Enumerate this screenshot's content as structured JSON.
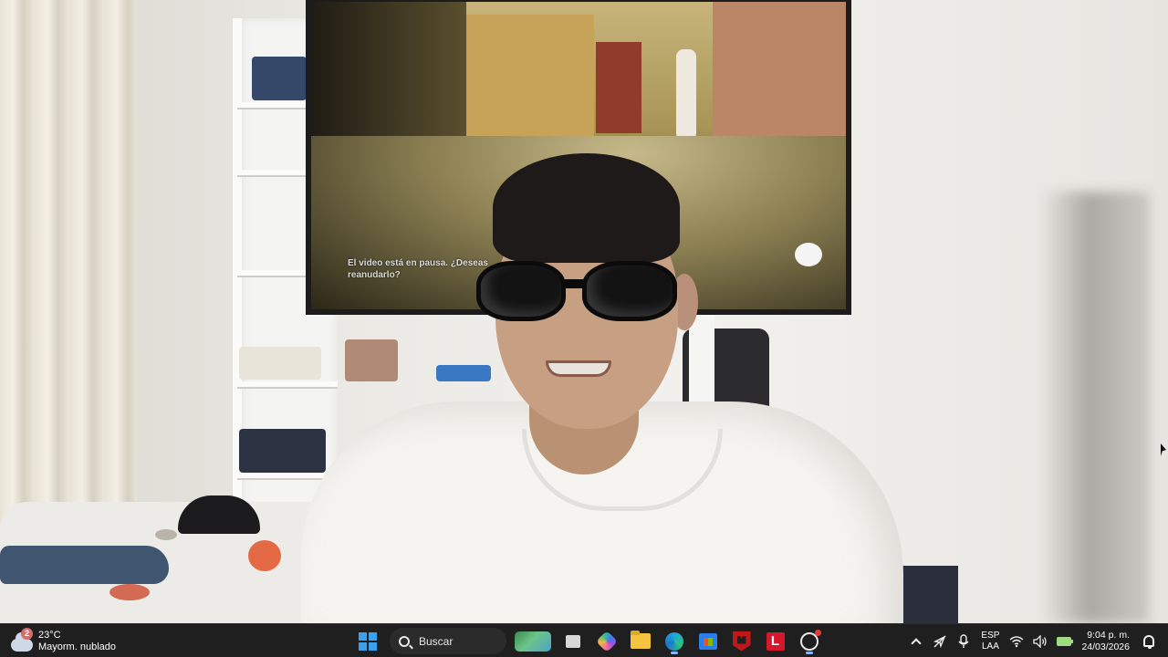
{
  "camera_feed": {
    "description": "",
    "tv_subtitle": "El video está en pausa. ¿Deseas reanudarlo?"
  },
  "taskbar": {
    "weather": {
      "temperature": "23°C",
      "condition": "Mayorm. nublado",
      "badge": "2"
    },
    "start_icon": "windows-logo",
    "search": {
      "label": "Buscar"
    },
    "pinned_apps": [
      {
        "name": "widgets",
        "icon": "widget-landscape"
      },
      {
        "name": "task-view",
        "icon": "taskview-icon"
      },
      {
        "name": "copilot",
        "icon": "copilot-icon"
      },
      {
        "name": "file-explorer",
        "icon": "folder-icon"
      },
      {
        "name": "edge",
        "icon": "edge-icon"
      },
      {
        "name": "microsoft-store",
        "icon": "store-icon"
      },
      {
        "name": "mcafee",
        "icon": "shield-icon"
      },
      {
        "name": "l-app",
        "icon": "l-icon",
        "label": "L"
      },
      {
        "name": "chatgpt",
        "icon": "chatgpt-icon"
      }
    ],
    "tray": {
      "language_top": "ESP",
      "language_bottom": "LAA",
      "time": "9:04 p. m.",
      "date": "24/03/2026"
    }
  },
  "colors": {
    "taskbar_bg": "#1f1f1f",
    "accent": "#3aa0f0"
  }
}
